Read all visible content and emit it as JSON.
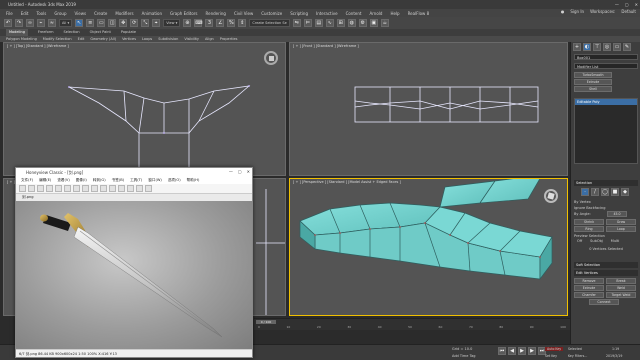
{
  "app": {
    "title": "Untitled - Autodesk 3ds Max 2019",
    "menus": [
      "File",
      "Edit",
      "Tools",
      "Group",
      "Views",
      "Create",
      "Modifiers",
      "Animation",
      "Graph Editors",
      "Rendering",
      "Civil View",
      "Customize",
      "Scripting",
      "Interactive",
      "Content",
      "Arnold",
      "Help",
      "RealFlow 8"
    ],
    "user": "Sign In",
    "workspaces_label": "Workspaces:",
    "workspace_value": "Default",
    "create_selection_set": "Create Selection Se"
  },
  "ribbon": {
    "tabs": [
      "Modeling",
      "Freeform",
      "Selection",
      "Object Paint",
      "Populate"
    ],
    "active_tab": "Modeling",
    "items": [
      "Polygon Modeling",
      "Modify Selection",
      "Edit",
      "Geometry (All)",
      "Vertices",
      "Loops",
      "Subdivision",
      "Visibility",
      "Align",
      "Properties"
    ]
  },
  "viewports": {
    "top_left": "[ + ] [Top] [Standard ] [Wireframe ]",
    "top_right": "[ + ] [Front ] [Standard ] [Wireframe ]",
    "bottom_right": "[ + ] [Perspective ] [Standard ] [Model Assist + Edged Faces ]",
    "bottom_left": "[ + ] [Left ] [Standard ] [Wireframe ]"
  },
  "command_panel": {
    "object_name": "Box001",
    "modifier_list": "Modifier List",
    "btn_turbosmooth": "TurboSmooth",
    "btn_extrude": "Extrude",
    "btn_shell": "Shell",
    "stack_item": "Editable Poly",
    "selection_head": "Selection",
    "by_vertex": "By Vertex",
    "ignore_backfacing": "Ignore Backfacing",
    "by_angle": "By Angle:",
    "angle_value": "45.0",
    "btn_shrink": "Shrink",
    "btn_grow": "Grow",
    "btn_ring": "Ring",
    "btn_loop": "Loop",
    "preview_selection": "Preview Selection",
    "opt_off": "Off",
    "opt_subobj": "SubObj",
    "opt_multi": "Multi",
    "vertices_selected": "0 Vertices Selected",
    "soft_selection_head": "Soft Selection",
    "edit_vertices_head": "Edit Vertices",
    "btn_remove": "Remove",
    "btn_break": "Break",
    "btn_extrude2": "Extrude",
    "btn_weld": "Weld",
    "btn_chamfer": "Chamfer",
    "btn_target_weld": "Target Weld",
    "btn_connect": "Connect"
  },
  "image_viewer": {
    "title": "Honeyview Classic - [剑.png]",
    "menus": [
      "文件(F)",
      "编辑(E)",
      "查看(V)",
      "图像(I)",
      "转到(G)",
      "书签(B)",
      "工具(T)",
      "窗口(W)",
      "选项(O)",
      "帮助(H)"
    ],
    "tab": "剑.png",
    "status": "6/7  剑.png 86.44 KB  900x600x24  1:50  100%  X:416 Y:13"
  },
  "timeline": {
    "frame": "0 / 100",
    "ticks": [
      "0",
      "10",
      "20",
      "30",
      "40",
      "50",
      "60",
      "70",
      "80",
      "90",
      "100"
    ]
  },
  "statusbar": {
    "grid": "Grid = 10.0",
    "add_time_tag": "Add Time Tag",
    "selected": "Selected",
    "auto_key": "Auto Key",
    "set_key": "Set Key",
    "key_filters": "Key Filters...",
    "clock": "1:19",
    "date": "2019/3/19"
  },
  "colors": {
    "accent": "#3b6ea5",
    "active_viewport": "#f0c000",
    "mesh_fill": "#7fd6d2",
    "mesh_edge": "#2e5f5f",
    "vertex": "#c04040"
  }
}
